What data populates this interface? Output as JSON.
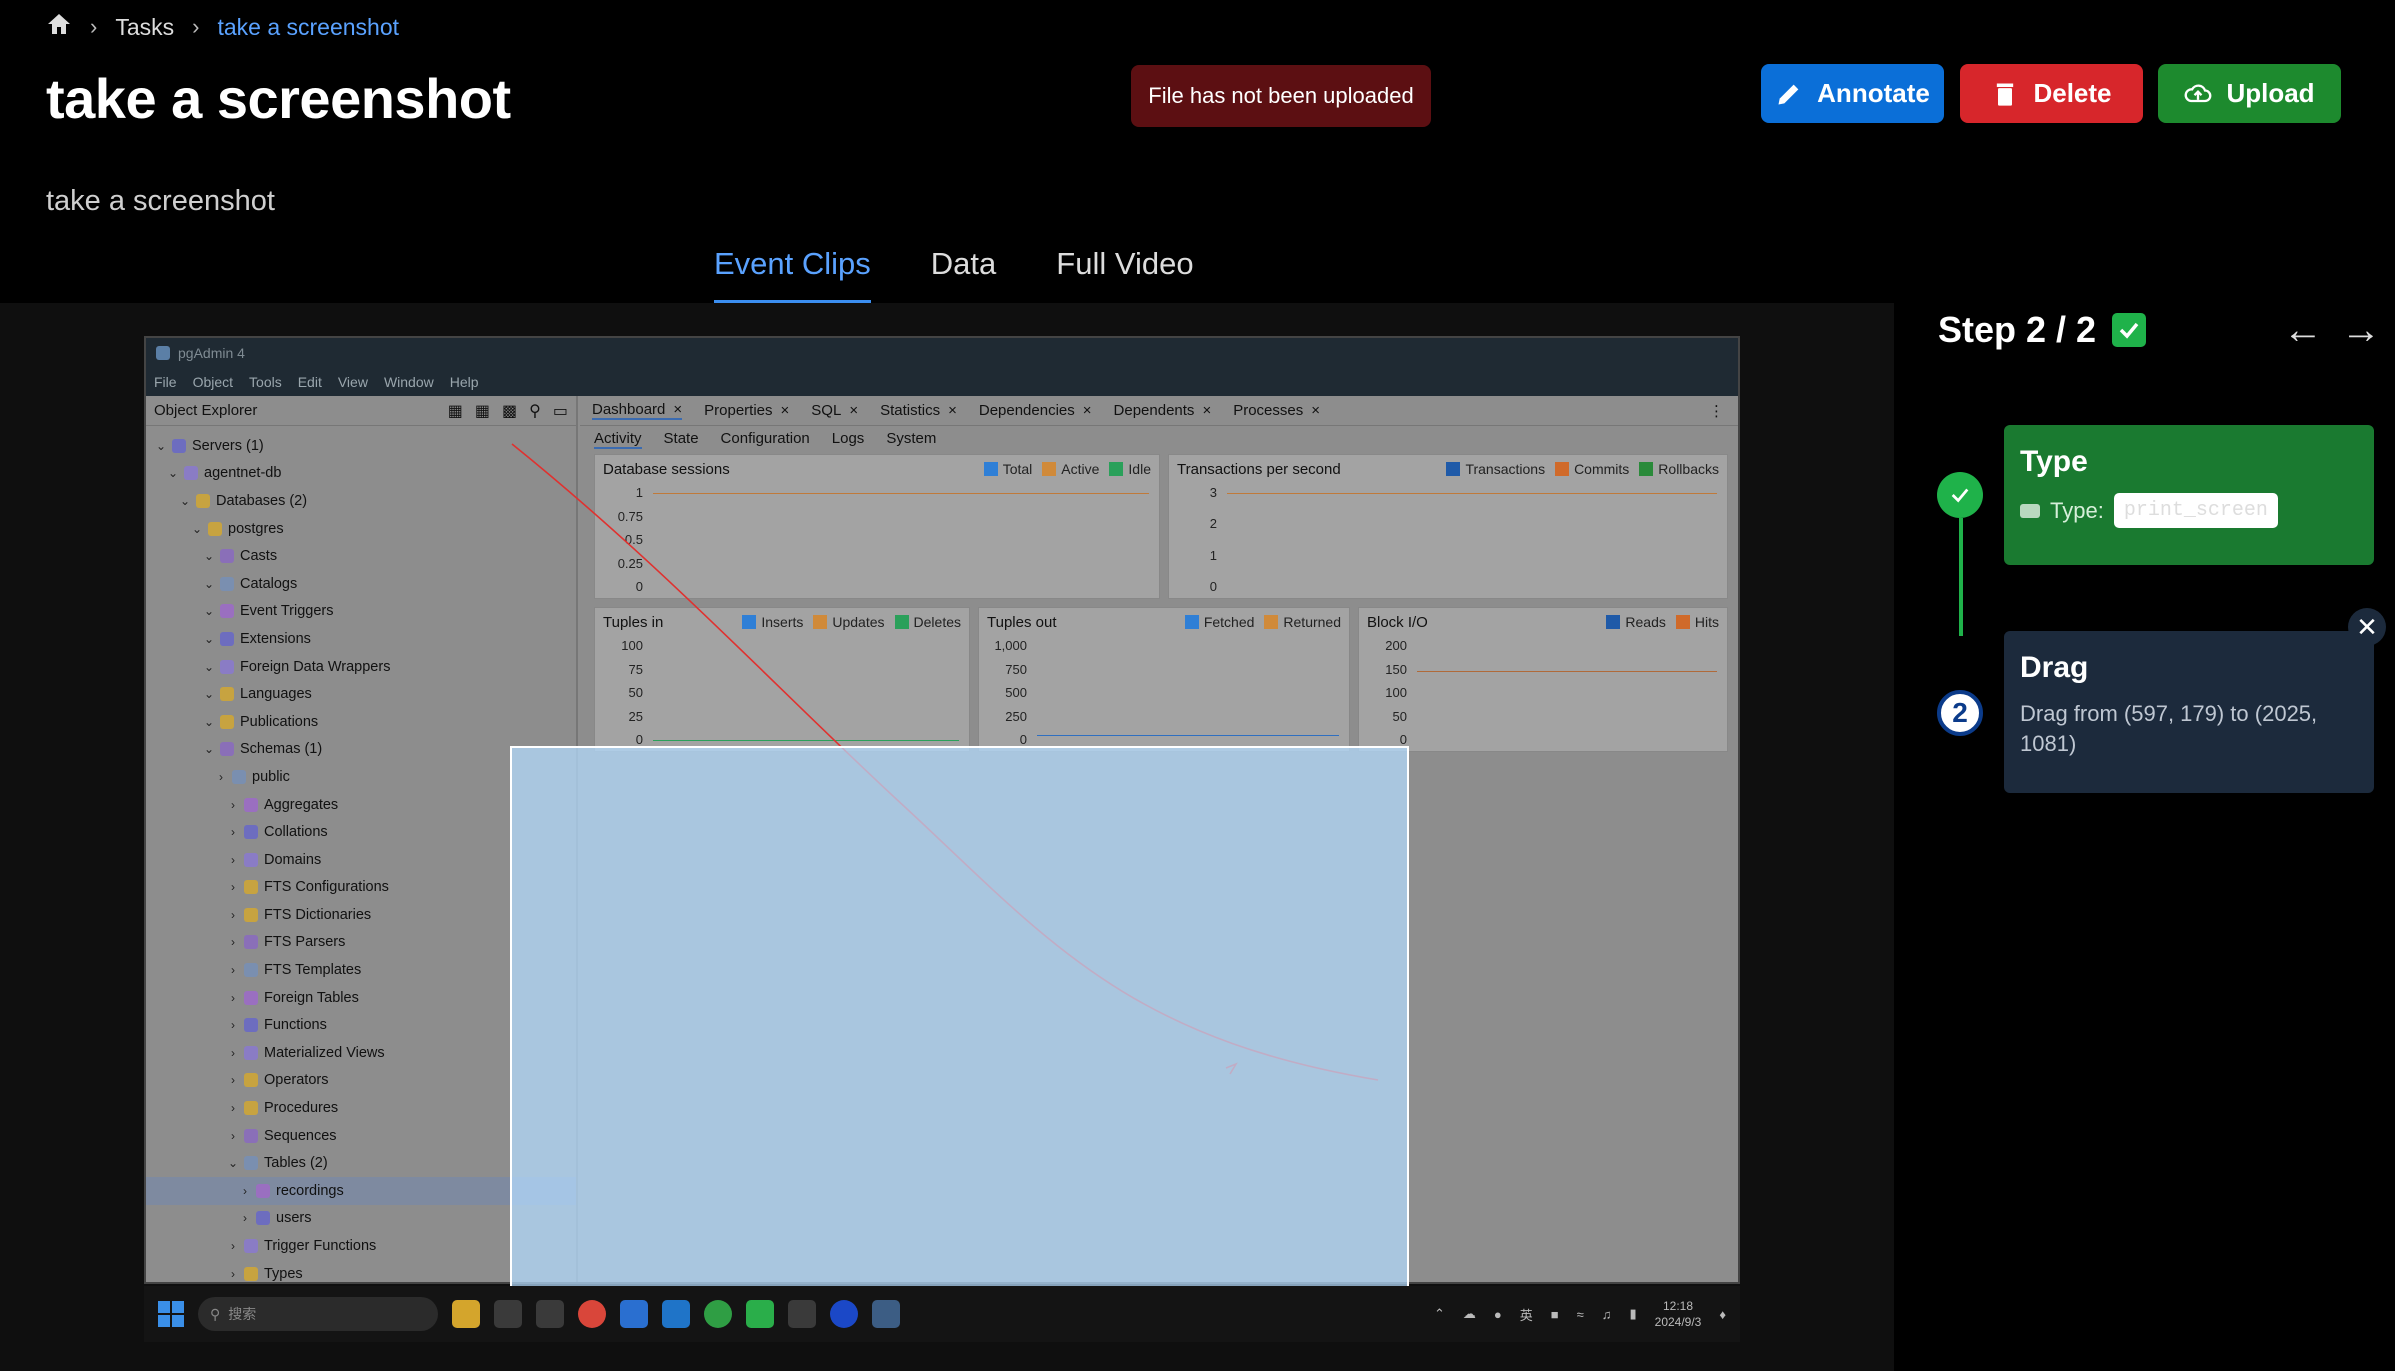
{
  "breadcrumb": {
    "home_icon": "home-icon",
    "items": [
      "Tasks",
      "take a screenshot"
    ]
  },
  "page": {
    "title": "take a screenshot",
    "subtitle": "take a screenshot"
  },
  "alert": "File has not been uploaded",
  "buttons": {
    "annotate": "Annotate",
    "delete": "Delete",
    "upload": "Upload"
  },
  "tabs": [
    "Event Clips",
    "Data",
    "Full Video"
  ],
  "active_tab": "Event Clips",
  "screenshot": {
    "app_title": "pgAdmin 4",
    "menu": [
      "File",
      "Object",
      "Tools",
      "Edit",
      "View",
      "Window",
      "Help"
    ],
    "object_explorer": "Object Explorer",
    "tree": [
      {
        "label": "Servers (1)",
        "indent": 0
      },
      {
        "label": "agentnet-db",
        "indent": 1
      },
      {
        "label": "Databases (2)",
        "indent": 2
      },
      {
        "label": "postgres",
        "indent": 3
      },
      {
        "label": "Casts",
        "indent": 4
      },
      {
        "label": "Catalogs",
        "indent": 4
      },
      {
        "label": "Event Triggers",
        "indent": 4
      },
      {
        "label": "Extensions",
        "indent": 4
      },
      {
        "label": "Foreign Data Wrappers",
        "indent": 4
      },
      {
        "label": "Languages",
        "indent": 4
      },
      {
        "label": "Publications",
        "indent": 4
      },
      {
        "label": "Schemas (1)",
        "indent": 4
      },
      {
        "label": "public",
        "indent": 5
      },
      {
        "label": "Aggregates",
        "indent": 6
      },
      {
        "label": "Collations",
        "indent": 6
      },
      {
        "label": "Domains",
        "indent": 6
      },
      {
        "label": "FTS Configurations",
        "indent": 6
      },
      {
        "label": "FTS Dictionaries",
        "indent": 6
      },
      {
        "label": "FTS Parsers",
        "indent": 6
      },
      {
        "label": "FTS Templates",
        "indent": 6
      },
      {
        "label": "Foreign Tables",
        "indent": 6
      },
      {
        "label": "Functions",
        "indent": 6
      },
      {
        "label": "Materialized Views",
        "indent": 6
      },
      {
        "label": "Operators",
        "indent": 6
      },
      {
        "label": "Procedures",
        "indent": 6
      },
      {
        "label": "Sequences",
        "indent": 6
      },
      {
        "label": "Tables (2)",
        "indent": 6
      },
      {
        "label": "recordings",
        "indent": 7,
        "selected": true
      },
      {
        "label": "users",
        "indent": 7
      },
      {
        "label": "Trigger Functions",
        "indent": 6
      },
      {
        "label": "Types",
        "indent": 6
      }
    ],
    "dash_tabs": [
      "Dashboard",
      "Properties",
      "SQL",
      "Statistics",
      "Dependencies",
      "Dependents",
      "Processes"
    ],
    "sub_tabs": [
      "Activity",
      "State",
      "Configuration",
      "Logs",
      "System"
    ],
    "panels": {
      "db_sessions": {
        "title": "Database sessions",
        "legend": [
          "Total",
          "Active",
          "Idle"
        ],
        "ticks": [
          "1",
          "0.75",
          "0.5",
          "0.25",
          "0"
        ]
      },
      "tps": {
        "title": "Transactions per second",
        "legend": [
          "Transactions",
          "Commits",
          "Rollbacks"
        ],
        "ticks": [
          "3",
          "2",
          "1",
          "0"
        ]
      },
      "tuples_in": {
        "title": "Tuples in",
        "legend": [
          "Inserts",
          "Updates",
          "Deletes"
        ],
        "ticks": [
          "100",
          "75",
          "50",
          "25",
          "0"
        ]
      },
      "tuples_out": {
        "title": "Tuples out",
        "legend": [
          "Fetched",
          "Returned"
        ],
        "ticks": [
          "1,000",
          "750",
          "500",
          "250",
          "0"
        ]
      },
      "block_io": {
        "title": "Block I/O",
        "legend": [
          "Reads",
          "Hits"
        ],
        "ticks": [
          "200",
          "150",
          "100",
          "50",
          "0"
        ]
      }
    },
    "taskbar": {
      "search": "搜索",
      "ime": "英",
      "time": "12:18",
      "date": "2024/9/3"
    }
  },
  "step": {
    "label": "Step 2 / 2"
  },
  "steps": [
    {
      "title": "Type",
      "field_label": "Type:",
      "value": "print_screen"
    },
    {
      "number": "2",
      "title": "Drag",
      "description": "Drag from (597, 179) to (2025, 1081)"
    }
  ],
  "colors": {
    "accent": "#5aa2ff",
    "annotate": "#0b6fd8",
    "delete": "#d7262b",
    "upload": "#1d8a2e",
    "step_done": "#1fb24a",
    "alert_bg": "#5c0f12"
  }
}
